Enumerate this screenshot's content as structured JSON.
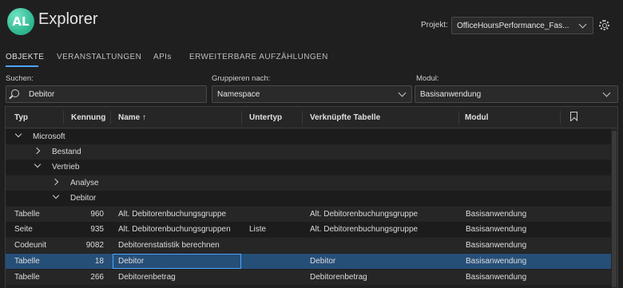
{
  "app": {
    "logo_text": "AL",
    "title": "Explorer"
  },
  "project": {
    "label": "Projekt:",
    "value": "OfficeHoursPerformance_Fas..."
  },
  "tabs": [
    {
      "label": "OBJEKTE",
      "active": true
    },
    {
      "label": "VERANSTALTUNGEN",
      "active": false
    },
    {
      "label": "APIs",
      "active": false
    },
    {
      "label": "ERWEITERBARE AUFZÄHLUNGEN",
      "active": false
    }
  ],
  "filters": {
    "search_label": "Suchen:",
    "search_value": "Debitor",
    "group_label": "Gruppieren nach:",
    "group_value": "Namespace",
    "module_label": "Modul:",
    "module_value": "Basisanwendung"
  },
  "grid": {
    "columns": {
      "typ": "Typ",
      "kennung": "Kennung",
      "name": "Name ↑",
      "untertyp": "Untertyp",
      "tabelle": "Verknüpfte Tabelle",
      "modul": "Modul"
    },
    "groups": [
      {
        "label": "Microsoft",
        "expanded": true
      },
      {
        "label": "Bestand",
        "expanded": false
      },
      {
        "label": "Vertrieb",
        "expanded": true
      },
      {
        "label": "Analyse",
        "expanded": false
      },
      {
        "label": "Debitor",
        "expanded": true
      }
    ],
    "rows": [
      {
        "typ": "Tabelle",
        "kennung": "960",
        "name": "Alt. Debitorenbuchungsgruppe",
        "untertyp": "",
        "tabelle": "Alt. Debitorenbuchungsgruppe",
        "modul": "Basisanwendung"
      },
      {
        "typ": "Seite",
        "kennung": "935",
        "name": "Alt. Debitorenbuchungsgruppen",
        "untertyp": "Liste",
        "tabelle": "Alt. Debitorenbuchungsgruppe",
        "modul": "Basisanwendung"
      },
      {
        "typ": "Codeunit",
        "kennung": "9082",
        "name": "Debitorenstatistik berechnen",
        "untertyp": "",
        "tabelle": "",
        "modul": "Basisanwendung"
      },
      {
        "typ": "Tabelle",
        "kennung": "18",
        "name": "Debitor",
        "untertyp": "",
        "tabelle": "Debitor",
        "modul": "Basisanwendung"
      },
      {
        "typ": "Tabelle",
        "kennung": "266",
        "name": "Debitorenbetrag",
        "untertyp": "",
        "tabelle": "Debitorenbetrag",
        "modul": "Basisanwendung"
      }
    ]
  },
  "colors": {
    "accent": "#4da3ff",
    "selected_row": "#264f78",
    "logo": "#2bb38e"
  }
}
